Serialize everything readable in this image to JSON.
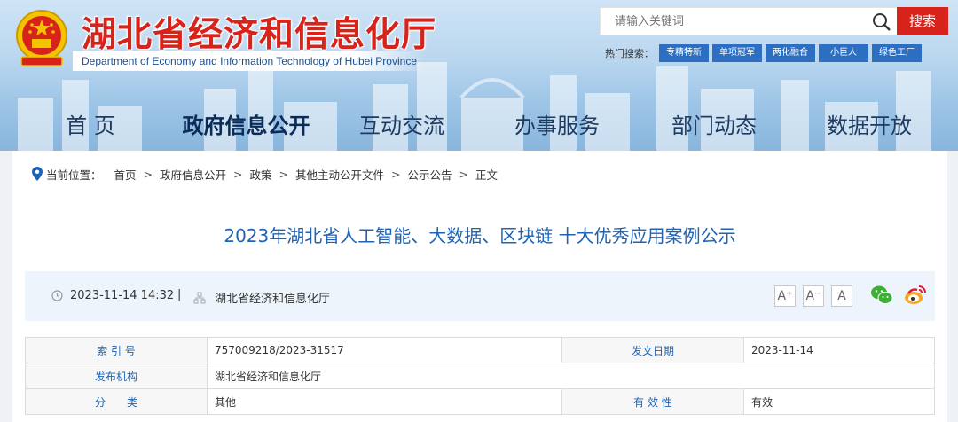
{
  "header": {
    "site_title": "湖北省经济和信息化厅",
    "site_title_en": "Department of Economy and Information Technology of Hubei Province",
    "search_placeholder": "请输入关键词",
    "search_button": "搜索",
    "hot_label": "热门搜索：",
    "hot_tags": [
      "专精特新",
      "单项冠军",
      "两化融合",
      "小巨人",
      "绿色工厂"
    ]
  },
  "nav": {
    "items": [
      "首 页",
      "政府信息公开",
      "互动交流",
      "办事服务",
      "部门动态",
      "数据开放"
    ],
    "active_index": 1
  },
  "breadcrumb": {
    "label": "当前位置：",
    "items": [
      "首页",
      "政府信息公开",
      "政策",
      "其他主动公开文件",
      "公示公告",
      "正文"
    ],
    "separator": ">"
  },
  "article": {
    "title": "2023年湖北省人工智能、大数据、区块链 十大优秀应用案例公示",
    "datetime": "2023-11-14 14:32",
    "meta_separator": "|",
    "source": "湖北省经济和信息化厅",
    "font_sizes": [
      "A⁺",
      "A⁻",
      "A"
    ],
    "share_icons": [
      "wechat-icon",
      "weibo-icon"
    ]
  },
  "info_table": {
    "index_label": "索 引 号",
    "index_value": "757009218/2023-31517",
    "date_label": "发文日期",
    "date_value": "2023-11-14",
    "issuer_label": "发布机构",
    "issuer_value": "湖北省经济和信息化厅",
    "category_label": "分　　类",
    "category_value": "其他",
    "validity_label": "有 效 性",
    "validity_value": "有效"
  },
  "colors": {
    "brand_red": "#d8231b",
    "title_blue": "#1f63b6",
    "tag_blue": "#2c6fc2"
  }
}
